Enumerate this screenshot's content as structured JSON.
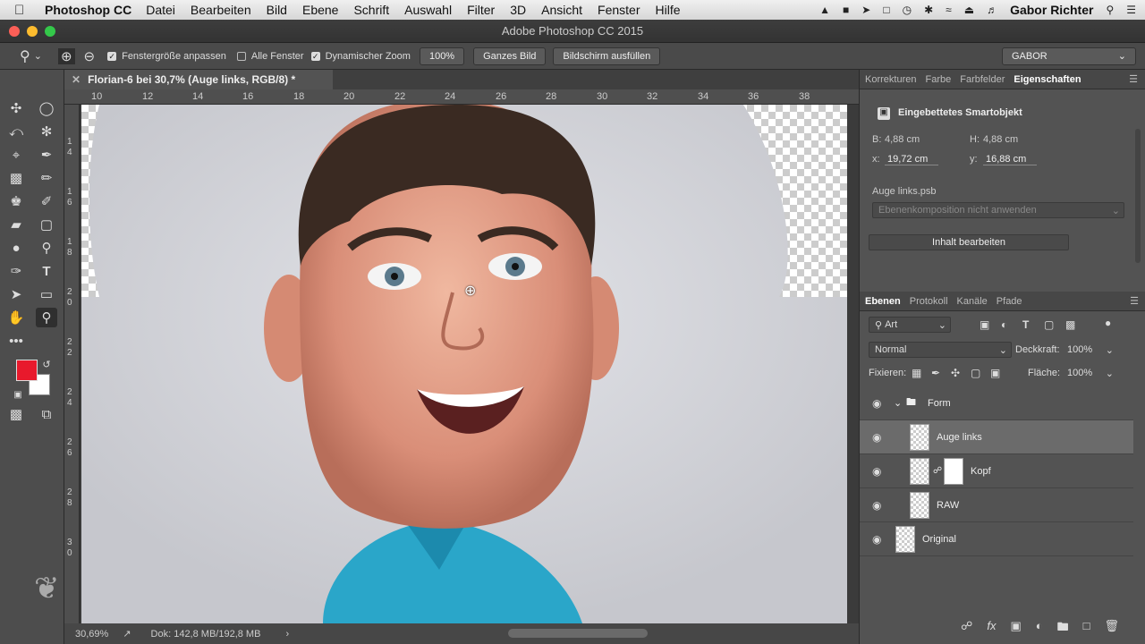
{
  "menubar": {
    "app": "Photoshop CC",
    "items": [
      "Datei",
      "Bearbeiten",
      "Bild",
      "Ebene",
      "Schrift",
      "Auswahl",
      "Filter",
      "3D",
      "Ansicht",
      "Fenster",
      "Hilfe"
    ],
    "user": "Gabor Richter"
  },
  "window": {
    "title": "Adobe Photoshop CC 2015"
  },
  "options": {
    "fit_window": "Fenstergröße anpassen",
    "all_windows": "Alle Fenster",
    "scrubby_zoom": "Dynamischer Zoom",
    "zoom_value": "100%",
    "fit_screen": "Ganzes Bild",
    "fill_screen": "Bildschirm ausfüllen",
    "workspace": "GABOR"
  },
  "document": {
    "tab_title": "Florian-6 bei 30,7% (Auge links, RGB/8) *",
    "ruler_h": [
      "10",
      "12",
      "14",
      "16",
      "18",
      "20",
      "22",
      "24",
      "26",
      "28",
      "30",
      "32",
      "34",
      "36",
      "38"
    ],
    "ruler_v": [
      "1\n4",
      "1\n6",
      "1\n8",
      "2\n0",
      "2\n2",
      "2\n4",
      "2\n6",
      "2\n8",
      "3\n0"
    ]
  },
  "status": {
    "zoom": "30,69%",
    "doc": "Dok: 142,8 MB/192,8 MB"
  },
  "colors": {
    "foreground": "#e8192c",
    "background": "#ffffff",
    "accent_selected_layer": "#6b6b6b"
  },
  "properties": {
    "tabs": [
      "Korrekturen",
      "Farbe",
      "Farbfelder",
      "Eigenschaften"
    ],
    "active_tab": "Eigenschaften",
    "type": "Eingebettetes Smartobjekt",
    "b_label": "B:",
    "b_value": "4,88 cm",
    "h_label": "H:",
    "h_value": "4,88 cm",
    "x_label": "x:",
    "x_value": "19,72 cm",
    "y_label": "y:",
    "y_value": "16,88 cm",
    "file": "Auge links.psb",
    "comp": "Ebenenkomposition nicht anwenden",
    "edit_button": "Inhalt bearbeiten"
  },
  "layers_panel": {
    "tabs": [
      "Ebenen",
      "Protokoll",
      "Kanäle",
      "Pfade"
    ],
    "active_tab": "Ebenen",
    "filter": "Art",
    "blend_mode": "Normal",
    "opacity_label": "Deckkraft:",
    "opacity": "100%",
    "lock_label": "Fixieren:",
    "fill_label": "Fläche:",
    "fill": "100%",
    "layers": [
      {
        "name": "Form",
        "type": "group"
      },
      {
        "name": "Auge links",
        "type": "smart",
        "selected": true
      },
      {
        "name": "Kopf",
        "type": "smart-masked"
      },
      {
        "name": "RAW",
        "type": "smart"
      },
      {
        "name": "Original",
        "type": "smart"
      }
    ]
  }
}
